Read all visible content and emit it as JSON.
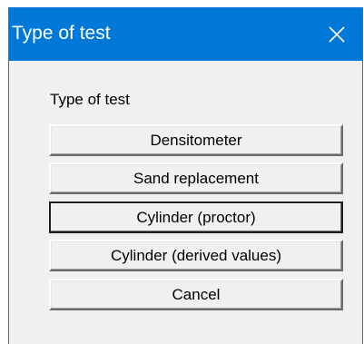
{
  "window": {
    "title": "Type of test",
    "close_glyph": "close-icon"
  },
  "dialog": {
    "group_label": "Type of test",
    "buttons": [
      {
        "label": "Densitometer"
      },
      {
        "label": "Sand replacement"
      },
      {
        "label": "Cylinder (proctor)"
      },
      {
        "label": "Cylinder (derived values)"
      },
      {
        "label": "Cancel"
      }
    ]
  },
  "colors": {
    "titlebar": "#0078d7",
    "title_text": "#ffffff",
    "client_bg": "#f0f0f0"
  }
}
